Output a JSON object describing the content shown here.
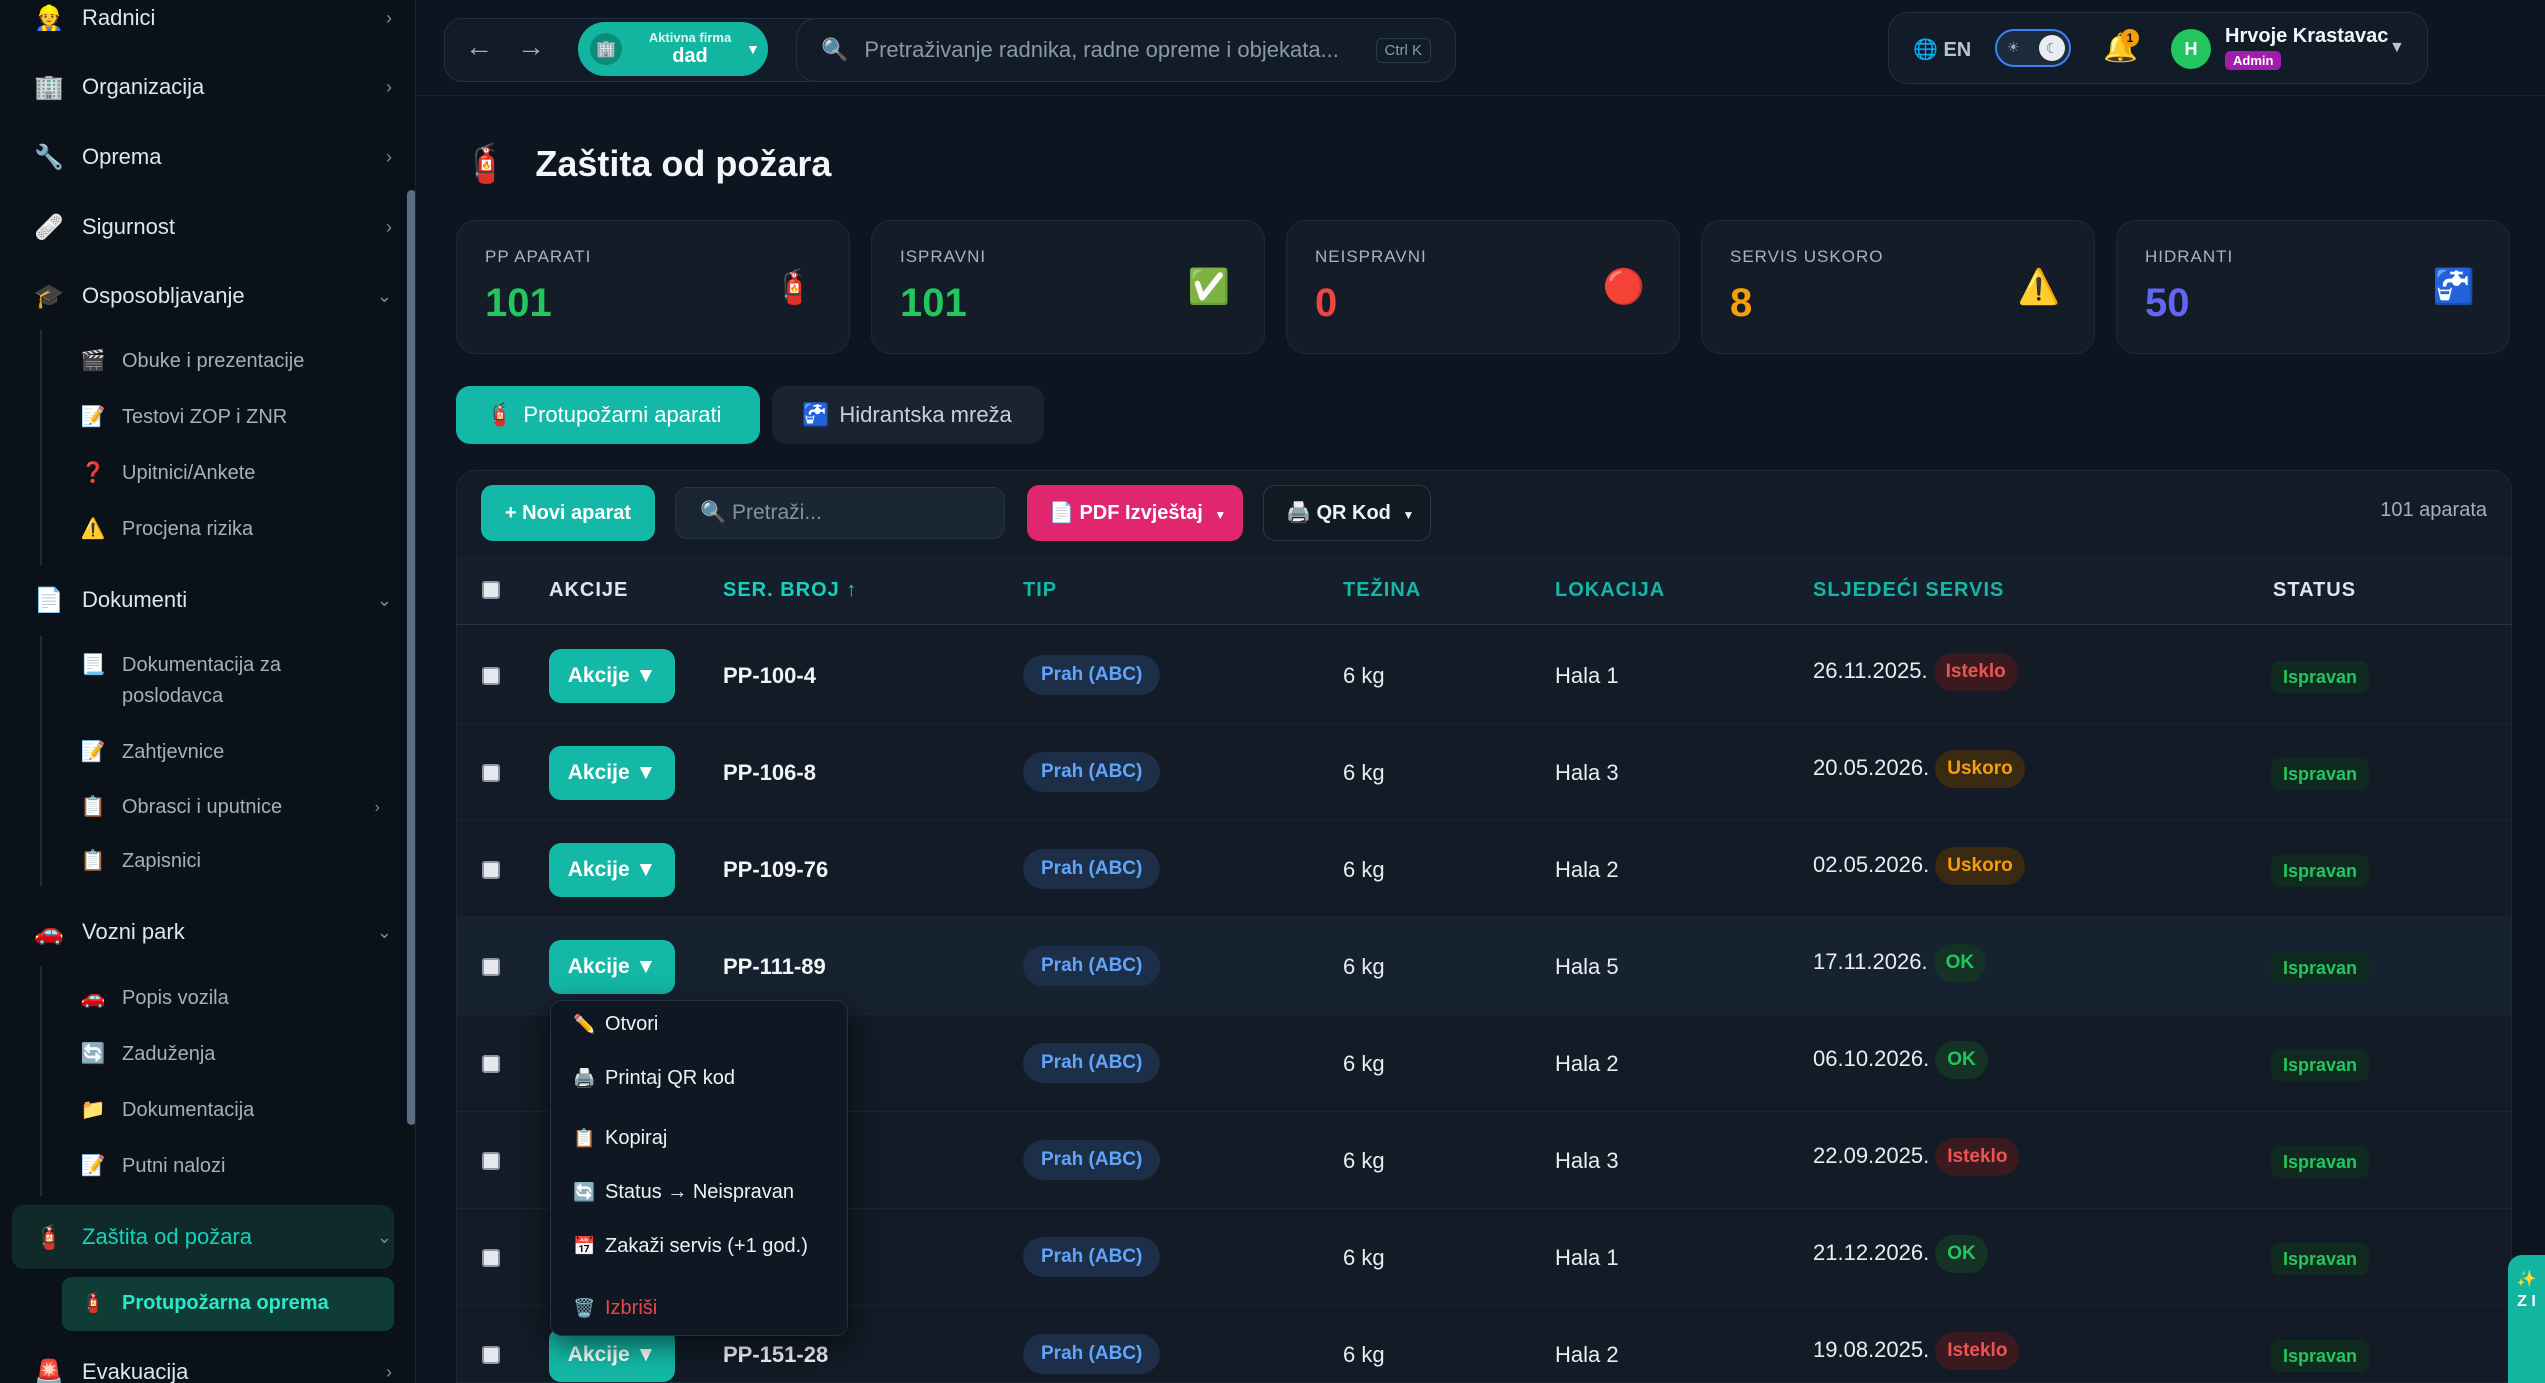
{
  "sidebar": {
    "items": [
      {
        "label": "Radnici",
        "icon": "worker-icon"
      },
      {
        "label": "Organizacija",
        "icon": "building-icon"
      },
      {
        "label": "Oprema",
        "icon": "drill-icon"
      },
      {
        "label": "Sigurnost",
        "icon": "bandage-icon"
      },
      {
        "label": "Osposobljavanje",
        "icon": "graduation-cap-icon"
      },
      {
        "label": "Dokumenti",
        "icon": "document-icon"
      },
      {
        "label": "Vozni park",
        "icon": "car-icon"
      },
      {
        "label": "Zaštita od požara",
        "icon": "fire-extinguisher-icon"
      },
      {
        "label": "Evakuacija",
        "icon": "siren-icon"
      }
    ],
    "sub_osposobljavanje": [
      {
        "label": "Obuke i prezentacije",
        "icon": "film-icon"
      },
      {
        "label": "Testovi ZOP i ZNR",
        "icon": "memo-icon"
      },
      {
        "label": "Upitnici/Ankete",
        "icon": "question-icon"
      },
      {
        "label": "Procjena rizika",
        "icon": "warning-icon"
      }
    ],
    "sub_dokumenti": [
      {
        "label": "Dokumentacija za poslodavca",
        "icon": "page-icon"
      },
      {
        "label": "Zahtjevnice",
        "icon": "memo-icon"
      },
      {
        "label": "Obrasci i uputnice",
        "icon": "clipboard-icon"
      },
      {
        "label": "Zapisnici",
        "icon": "clipboard-icon"
      }
    ],
    "sub_vozni_park": [
      {
        "label": "Popis vozila",
        "icon": "car-icon"
      },
      {
        "label": "Zaduženja",
        "icon": "refresh-icon"
      },
      {
        "label": "Dokumentacija",
        "icon": "folder-icon"
      },
      {
        "label": "Putni nalozi",
        "icon": "memo-icon"
      }
    ],
    "sub_zastita": [
      {
        "label": "Protupožarna oprema",
        "icon": "fire-extinguisher-icon"
      }
    ]
  },
  "topbar": {
    "back": "←",
    "forward": "→",
    "firm_label": "Aktivna firma",
    "firm_name": "dad",
    "search_placeholder": "Pretraživanje radnika, radne opreme i objekata...",
    "search_shortcut": "Ctrl K",
    "language": "EN",
    "notifications_count": "1",
    "user_initial": "H",
    "user_name": "Hrvoje Krastavac",
    "user_role": "Admin"
  },
  "page": {
    "title": "Zaštita od požara"
  },
  "stats": [
    {
      "label": "PP APARATI",
      "value": "101",
      "color": "#22c55e",
      "icon": "fire-extinguisher-icon"
    },
    {
      "label": "ISPRAVNI",
      "value": "101",
      "color": "#22c55e",
      "icon": "check-icon"
    },
    {
      "label": "NEISPRAVNI",
      "value": "0",
      "color": "#ef4444",
      "icon": "red-circle-icon"
    },
    {
      "label": "SERVIS USKORO",
      "value": "8",
      "color": "#f59e0b",
      "icon": "warning-icon"
    },
    {
      "label": "HIDRANTI",
      "value": "50",
      "color": "#6366f1",
      "icon": "water-tap-icon"
    }
  ],
  "tabs": [
    {
      "label": "Protupožarni aparati",
      "active": true
    },
    {
      "label": "Hidrantska mreža",
      "active": false
    }
  ],
  "toolbar": {
    "new_label": "+ Novi aparat",
    "search_placeholder": "Pretraži...",
    "pdf_label": "PDF Izvještaj",
    "qr_label": "QR Kod",
    "count_label": "101 aparata"
  },
  "table": {
    "columns": [
      "AKCIJE",
      "SER. BROJ ↑",
      "TIP",
      "TEŽINA",
      "LOKACIJA",
      "SLJEDEĆI SERVIS",
      "STATUS"
    ],
    "action_label": "Akcije ▼",
    "rows": [
      {
        "ser": "PP-100-4",
        "tip": "Prah (ABC)",
        "tezina": "6 kg",
        "lokacija": "Hala 1",
        "servis": "26.11.2025.",
        "badge": "Isteklo",
        "status": "Ispravan"
      },
      {
        "ser": "PP-106-8",
        "tip": "Prah (ABC)",
        "tezina": "6 kg",
        "lokacija": "Hala 3",
        "servis": "20.05.2026.",
        "badge": "Uskoro",
        "status": "Ispravan"
      },
      {
        "ser": "PP-109-76",
        "tip": "Prah (ABC)",
        "tezina": "6 kg",
        "lokacija": "Hala 2",
        "servis": "02.05.2026.",
        "badge": "Uskoro",
        "status": "Ispravan"
      },
      {
        "ser": "PP-111-89",
        "tip": "Prah (ABC)",
        "tezina": "6 kg",
        "lokacija": "Hala 5",
        "servis": "17.11.2026.",
        "badge": "OK",
        "status": "Ispravan"
      },
      {
        "ser": "",
        "tip": "Prah (ABC)",
        "tezina": "6 kg",
        "lokacija": "Hala 2",
        "servis": "06.10.2026.",
        "badge": "OK",
        "status": "Ispravan"
      },
      {
        "ser": "",
        "tip": "Prah (ABC)",
        "tezina": "6 kg",
        "lokacija": "Hala 3",
        "servis": "22.09.2025.",
        "badge": "Isteklo",
        "status": "Ispravan"
      },
      {
        "ser": "",
        "tip": "Prah (ABC)",
        "tezina": "6 kg",
        "lokacija": "Hala 1",
        "servis": "21.12.2026.",
        "badge": "OK",
        "status": "Ispravan"
      },
      {
        "ser": "PP-151-28",
        "tip": "Prah (ABC)",
        "tezina": "6 kg",
        "lokacija": "Hala 2",
        "servis": "19.08.2025.",
        "badge": "Isteklo",
        "status": "Ispravan"
      }
    ]
  },
  "action_menu": {
    "items": [
      {
        "label": "Otvori",
        "icon": "pencil-icon"
      },
      {
        "label": "Printaj QR kod",
        "icon": "printer-icon"
      },
      {
        "label": "Kopiraj",
        "icon": "copy-icon"
      },
      {
        "label": "Status → Neispravan",
        "icon": "refresh-icon"
      },
      {
        "label": "Zakaži servis (+1 god.)",
        "icon": "calendar-icon"
      },
      {
        "label": "Izbriši",
        "icon": "trash-icon"
      }
    ]
  },
  "float_tab": {
    "label": "Z I"
  }
}
